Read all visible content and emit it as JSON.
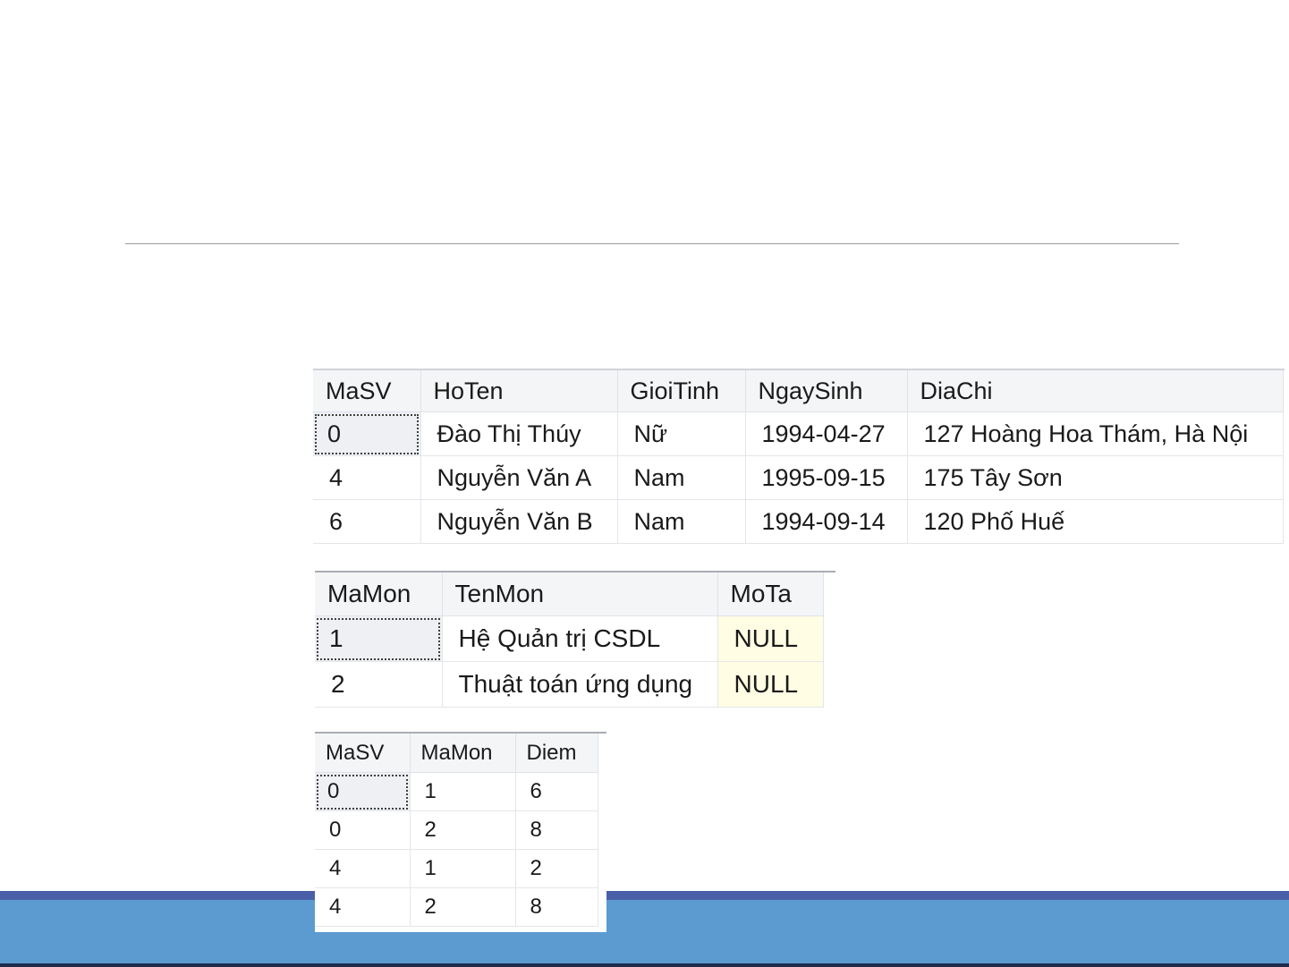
{
  "tables": [
    {
      "columns": [
        "MaSV",
        "HoTen",
        "GioiTinh",
        "NgaySinh",
        "DiaChi"
      ],
      "rows": [
        [
          "0",
          "Đào Thị Thúy",
          "Nữ",
          "1994-04-27",
          "127 Hoàng Hoa Thám, Hà Nội"
        ],
        [
          "4",
          "Nguyễn Văn A",
          "Nam",
          "1995-09-15",
          "175 Tây Sơn"
        ],
        [
          "6",
          "Nguyễn Văn B",
          "Nam",
          "1994-09-14",
          "120 Phố Huế"
        ]
      ]
    },
    {
      "columns": [
        "MaMon",
        "TenMon",
        "MoTa"
      ],
      "rows": [
        [
          "1",
          "Hệ Quản trị CSDL",
          "NULL"
        ],
        [
          "2",
          "Thuật toán ứng dụng",
          "NULL"
        ]
      ]
    },
    {
      "columns": [
        "MaSV",
        "MaMon",
        "Diem"
      ],
      "rows": [
        [
          "0",
          "1",
          "6"
        ],
        [
          "0",
          "2",
          "8"
        ],
        [
          "4",
          "1",
          "2"
        ],
        [
          "4",
          "2",
          "8"
        ]
      ]
    }
  ],
  "colors": {
    "footer_band": "#5b9bd0",
    "footer_top_line": "#4a5fa8",
    "null_cell": "#fffde3",
    "header_bg": "#f4f5f7"
  }
}
